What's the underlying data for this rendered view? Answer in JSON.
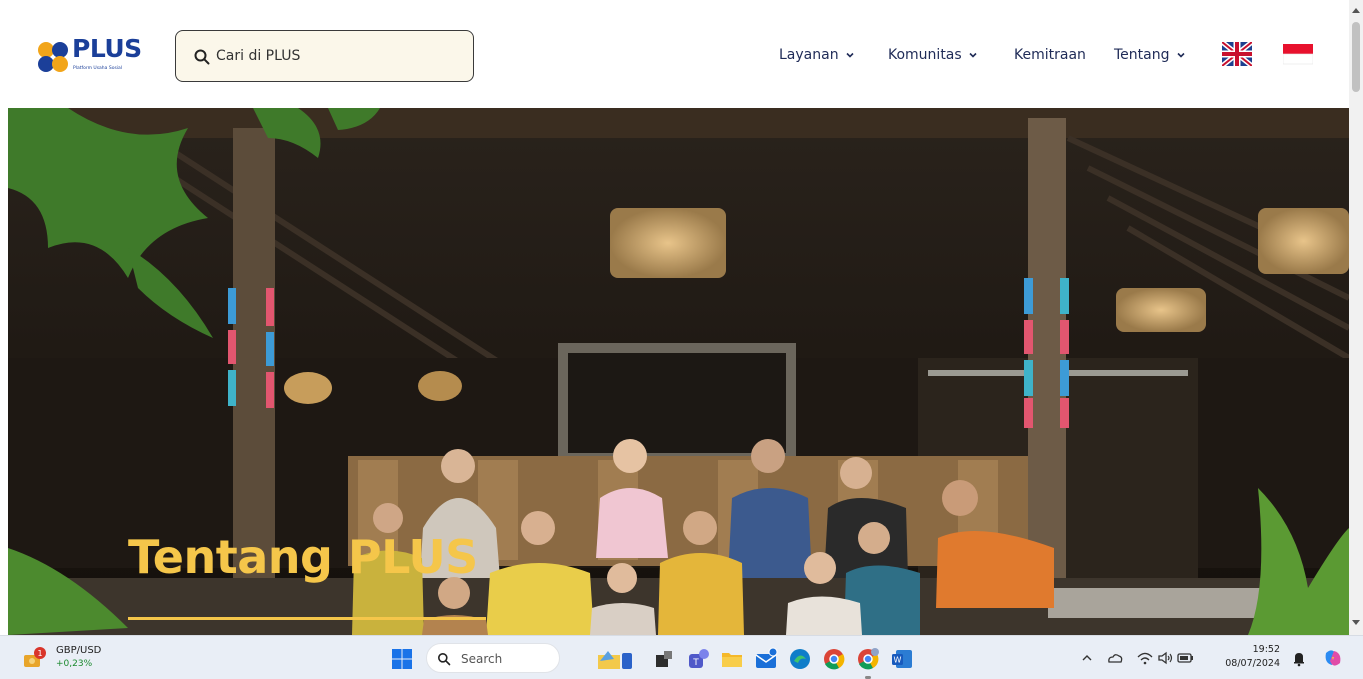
{
  "header": {
    "logo": {
      "name": "PLUS",
      "tagline": "Platform Usaha Sosial"
    },
    "search": {
      "placeholder": "Cari di PLUS"
    },
    "nav": [
      {
        "label": "Layanan",
        "has_dropdown": true
      },
      {
        "label": "Komunitas",
        "has_dropdown": true
      },
      {
        "label": "Kemitraan",
        "has_dropdown": false
      },
      {
        "label": "Tentang",
        "has_dropdown": true
      }
    ],
    "languages": [
      {
        "icon": "uk-flag-icon"
      },
      {
        "icon": "indonesia-flag-icon"
      }
    ]
  },
  "hero": {
    "title": "Tentang PLUS"
  },
  "taskbar": {
    "widget": {
      "name": "GBP/USD",
      "change": "+0,23%",
      "badge": "1"
    },
    "search_placeholder": "Search",
    "apps": [
      "windows-start-icon",
      "file-explorer-icon",
      "task-view-icon",
      "teams-icon",
      "folder-icon",
      "mail-icon",
      "edge-icon",
      "chrome-icon",
      "chrome-profile-icon",
      "word-icon"
    ],
    "tray": [
      "chevron-up-icon",
      "onedrive-icon",
      "wifi-icon",
      "volume-icon",
      "battery-icon",
      "notification-bell-icon",
      "copilot-icon"
    ],
    "time": "19:52",
    "date": "08/07/2024"
  },
  "colors": {
    "brand_blue": "#1b3f99",
    "brand_yellow": "#f5c64a",
    "search_bg": "#fbf7ea",
    "nav_text": "#1f2b57"
  }
}
